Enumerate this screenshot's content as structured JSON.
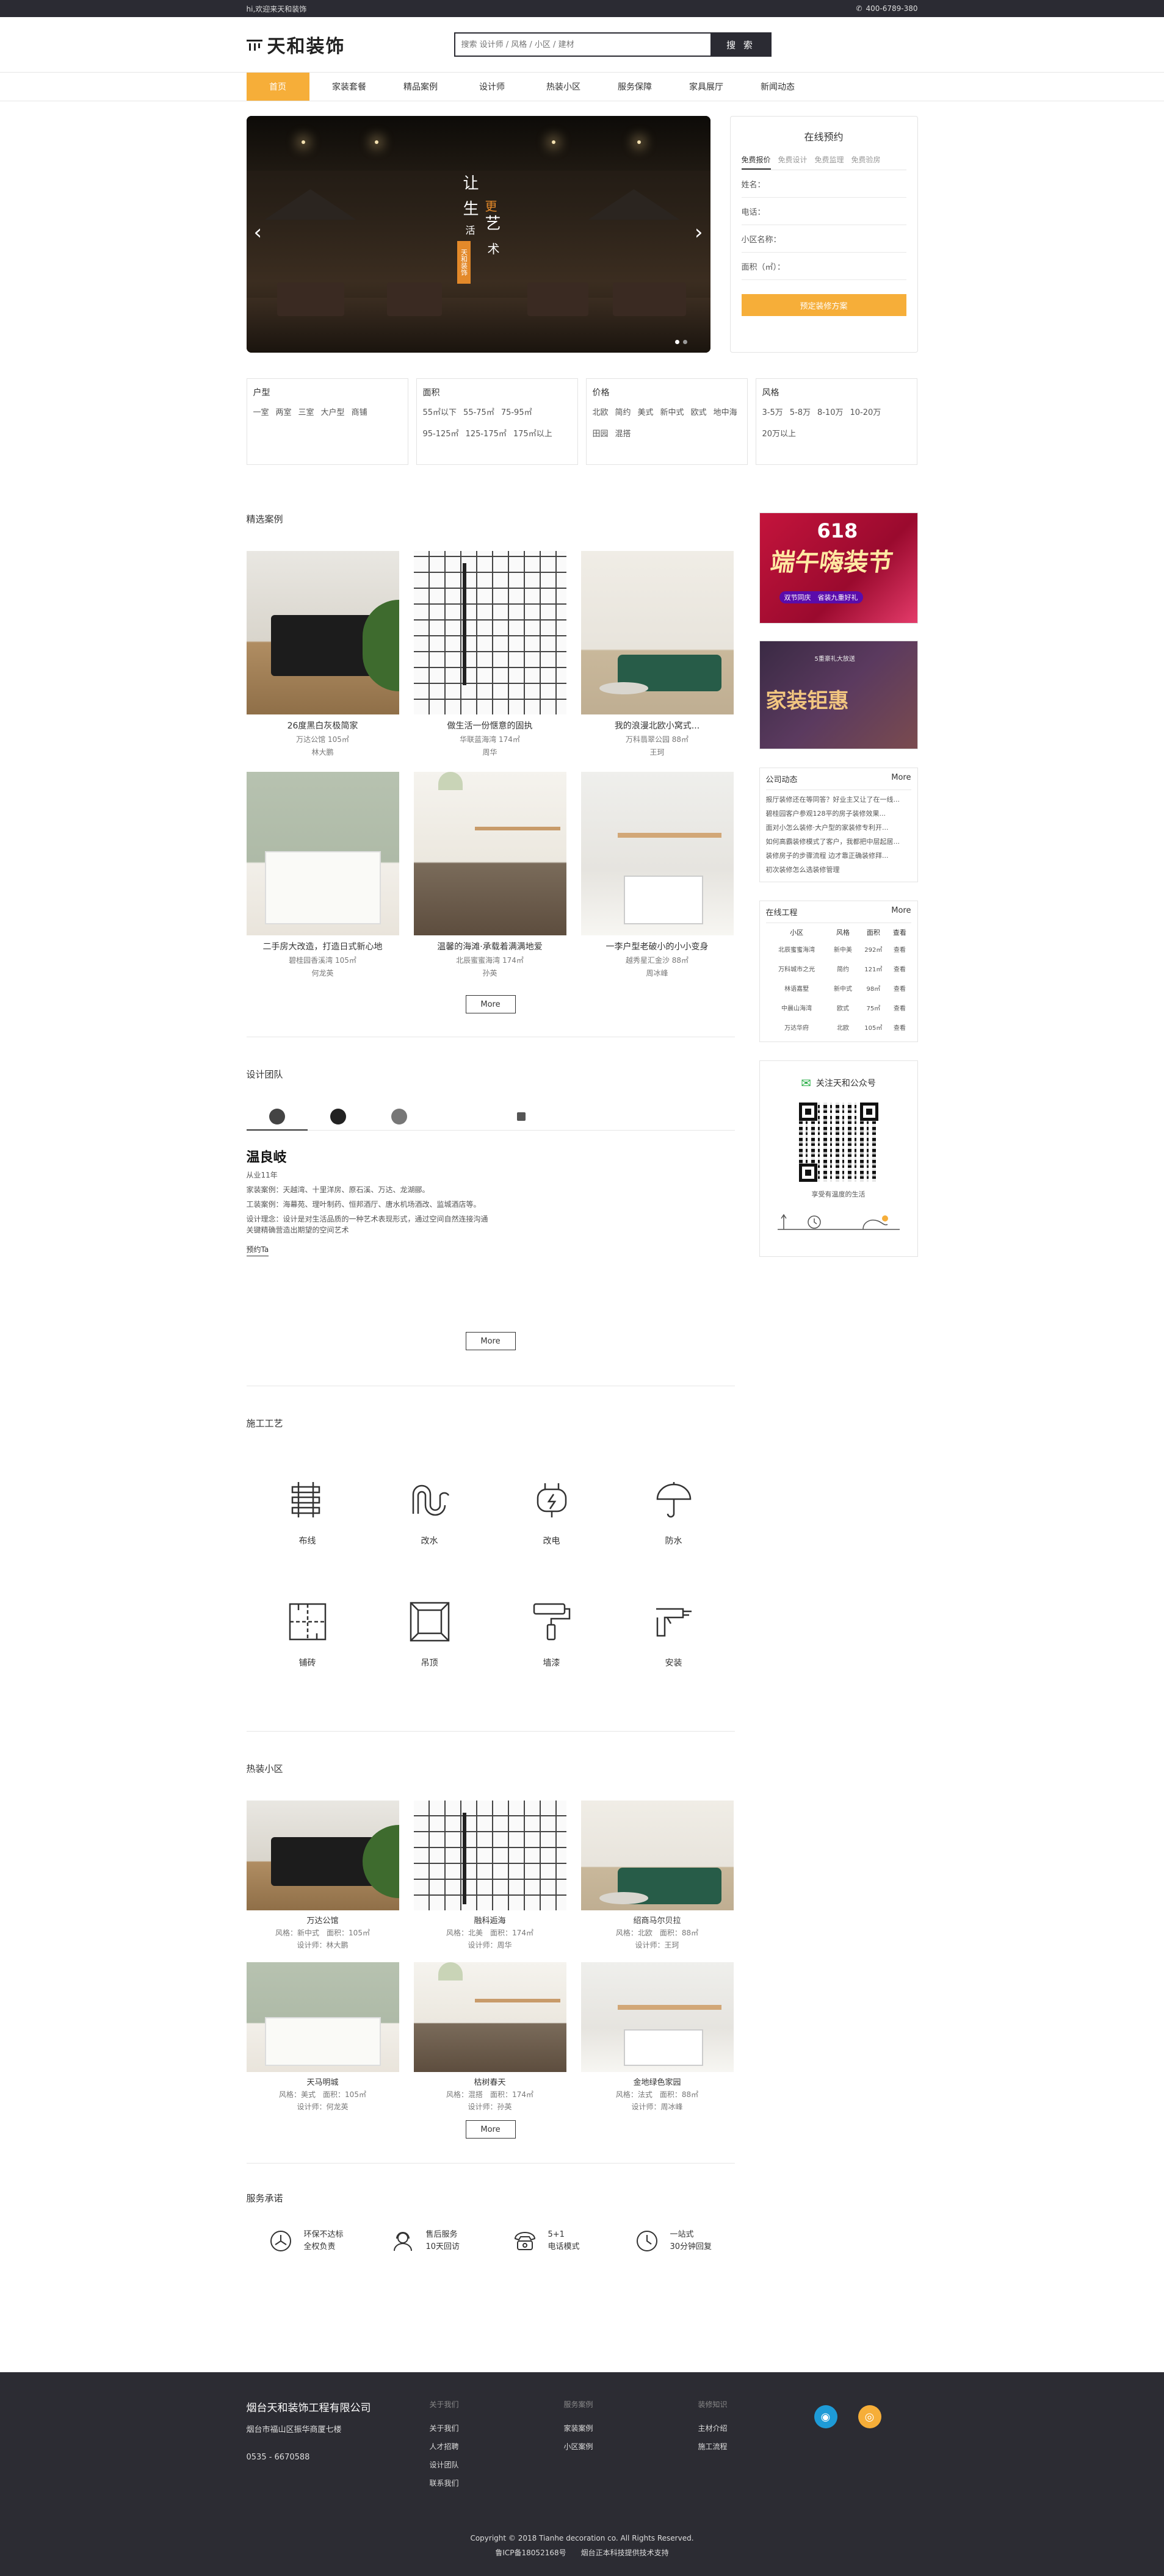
{
  "topbar": {
    "welcome": "hi,欢迎来天和装饰",
    "phone": "400-6789-380"
  },
  "header": {
    "logo_text": "天和装饰",
    "search_placeholder": "搜索 设计师 / 风格 / 小区 / 建材",
    "search_button": "搜 索"
  },
  "nav": [
    "首页",
    "家装套餐",
    "精品案例",
    "设计师",
    "热装小区",
    "服务保障",
    "家具展厅",
    "新闻动态"
  ],
  "banner": {
    "slogan_chars": [
      "让",
      "生",
      "活",
      "更",
      "艺",
      "术"
    ],
    "tag": "天和装饰"
  },
  "appointment": {
    "title": "在线预约",
    "tabs": [
      "免费报价",
      "免费设计",
      "免费监理",
      "免费验房"
    ],
    "fields": [
      "姓名：",
      "电话：",
      "小区名称：",
      "面积（㎡）："
    ],
    "submit": "预定装修方案"
  },
  "filters": [
    {
      "title": "户型",
      "options": [
        "一室",
        "两室",
        "三室",
        "大户型",
        "商铺"
      ]
    },
    {
      "title": "面积",
      "options": [
        "55㎡以下",
        "55-75㎡",
        "75-95㎡",
        "95-125㎡",
        "125-175㎡",
        "175㎡以上"
      ]
    },
    {
      "title": "价格",
      "options": [
        "北欧",
        "简约",
        "美式",
        "新中式",
        "欧式",
        "地中海",
        "田园",
        "混搭"
      ]
    },
    {
      "title": "风格",
      "options": [
        "3-5万",
        "5-8万",
        "8-10万",
        "10-20万",
        "20万以上"
      ]
    }
  ],
  "cases": {
    "title": "精选案例",
    "items": [
      {
        "title": "26度黑白灰极简家",
        "sub1": "万达公馆 105㎡",
        "sub2": "林大鹏"
      },
      {
        "title": "做生活一份惬意的固执",
        "sub1": "华联蓝海湾 174㎡",
        "sub2": "周华"
      },
      {
        "title": "我的浪漫北欧小窝式...",
        "sub1": "万科翡翠公园 88㎡",
        "sub2": "王珂"
      },
      {
        "title": "二手房大改造，打造日式新心地",
        "sub1": "碧桂园香溪湾 105㎡",
        "sub2": "何龙英"
      },
      {
        "title": "温馨的海滩·承载着满满地爱",
        "sub1": "北辰蜜蜜海湾 174㎡",
        "sub2": "孙英"
      },
      {
        "title": "一李户型老破小的小小变身",
        "sub1": "越秀星汇金沙 88㎡",
        "sub2": "周冰峰"
      }
    ],
    "more": "More"
  },
  "team": {
    "title": "设计团队",
    "designer": {
      "name": "温良岐",
      "years": "从业11年",
      "line1": "家装案例：天越湾、十里洋房、原石溪、万达、龙湖郦。",
      "line2": "工装案例：海幕苑、理叶制药、恒邦酒厅、唐水机场酒改、监城酒店等。",
      "line3": "设计理念：设计是对生活品质的一种艺术表现形式，通过空间自然连接沟通关键精确营造出期望的空间艺术",
      "book": "预约Ta"
    },
    "more": "More"
  },
  "craft": {
    "title": "施工工艺",
    "items": [
      {
        "label": "布线",
        "icon": "wiring-icon"
      },
      {
        "label": "改水",
        "icon": "water-pipe-icon"
      },
      {
        "label": "改电",
        "icon": "electric-plug-icon"
      },
      {
        "label": "防水",
        "icon": "umbrella-icon"
      },
      {
        "label": "铺砖",
        "icon": "tile-icon"
      },
      {
        "label": "吊顶",
        "icon": "ceiling-icon"
      },
      {
        "label": "墙漆",
        "icon": "paint-roller-icon"
      },
      {
        "label": "安装",
        "icon": "drill-icon"
      }
    ]
  },
  "hot": {
    "title": "热装小区",
    "items": [
      {
        "title": "万达公馆",
        "sub1": "风格：新中式　面积：105㎡",
        "sub2": "设计师：林大鹏"
      },
      {
        "title": "融科逅海",
        "sub1": "风格：北美　面积：174㎡",
        "sub2": "设计师：周华"
      },
      {
        "title": "绍商马尔贝拉",
        "sub1": "风格：北欧　面积：88㎡",
        "sub2": "设计师：王珂"
      },
      {
        "title": "天马明城",
        "sub1": "风格：美式　面积：105㎡",
        "sub2": "设计师：何龙英"
      },
      {
        "title": "枯树春天",
        "sub1": "风格：混搭　面积：174㎡",
        "sub2": "设计师：孙英"
      },
      {
        "title": "金地绿色家园",
        "sub1": "风格：法式　面积：88㎡",
        "sub2": "设计师：周冰峰"
      }
    ],
    "more": "More"
  },
  "service": {
    "title": "服务承诺",
    "items": [
      {
        "l1": "环保不达标",
        "l2": "全权负责",
        "icon": "recycle-icon"
      },
      {
        "l1": "售后服务",
        "l2": "10天回访",
        "icon": "customer-service-icon"
      },
      {
        "l1": "5+1",
        "l2": "电话模式",
        "icon": "phone-icon"
      },
      {
        "l1": "一站式",
        "l2": "30分钟回复",
        "icon": "clock-icon"
      }
    ]
  },
  "ads": {
    "ad1_num": "618",
    "ad1_big": "端午嗨装节",
    "ad1_sub": "双节同庆　省装九重好礼",
    "ad2_small": "5重豪礼大放送",
    "ad2_big": "家装钜惠"
  },
  "company_news": {
    "title": "公司动态",
    "more": "More",
    "items": [
      "报厅装修还在等同答？好业主又让了在一线...",
      "碧桂园客户参观128平的房子装修效果...",
      "面对小怎么装修·大户型的家装修专利开...",
      "如何高霸装修模式了客户，我都把中层起居...",
      "装修房子的步骤流程 边才靠正确装修拜...",
      "初次装修怎么选装修管理"
    ]
  },
  "projects": {
    "title": "在线工程",
    "more": "More",
    "headers": [
      "小区",
      "风格",
      "面积",
      "查看"
    ],
    "rows": [
      [
        "北辰蜜蜜海湾",
        "新中美",
        "292㎡",
        "查看"
      ],
      [
        "万科城市之光",
        "简约",
        "121㎡",
        "查看"
      ],
      [
        "林语嘉墅",
        "新中式",
        "98㎡",
        "查看"
      ],
      [
        "中晨山海湾",
        "欧式",
        "75㎡",
        "查看"
      ],
      [
        "万达华府",
        "北欧",
        "105㎡",
        "查看"
      ]
    ]
  },
  "wechat": {
    "title": "关注天和公众号",
    "tip": "享受有温度的生活"
  },
  "footer": {
    "company": "烟台天和装饰工程有限公司",
    "address": "烟台市福山区振华商厦七楼",
    "tel": "0535 - 6670588",
    "cols": [
      {
        "title": "关于我们",
        "links": [
          "关于我们",
          "人才招聘",
          "设计团队",
          "联系我们"
        ]
      },
      {
        "title": "服务案例",
        "links": [
          "家装案例",
          "小区案例"
        ]
      },
      {
        "title": "装修知识",
        "links": [
          "主材介绍",
          "施工流程"
        ]
      }
    ],
    "copyright": "Copyright © 2018 Tianhe decoration co. All Rights Reserved.",
    "icp": "鲁ICP备18052168号　　烟台正本科技提供技术支持"
  },
  "colors": {
    "accent": "#f6ae39",
    "dark": "#2b2b33",
    "footer": "#2c2c33"
  }
}
